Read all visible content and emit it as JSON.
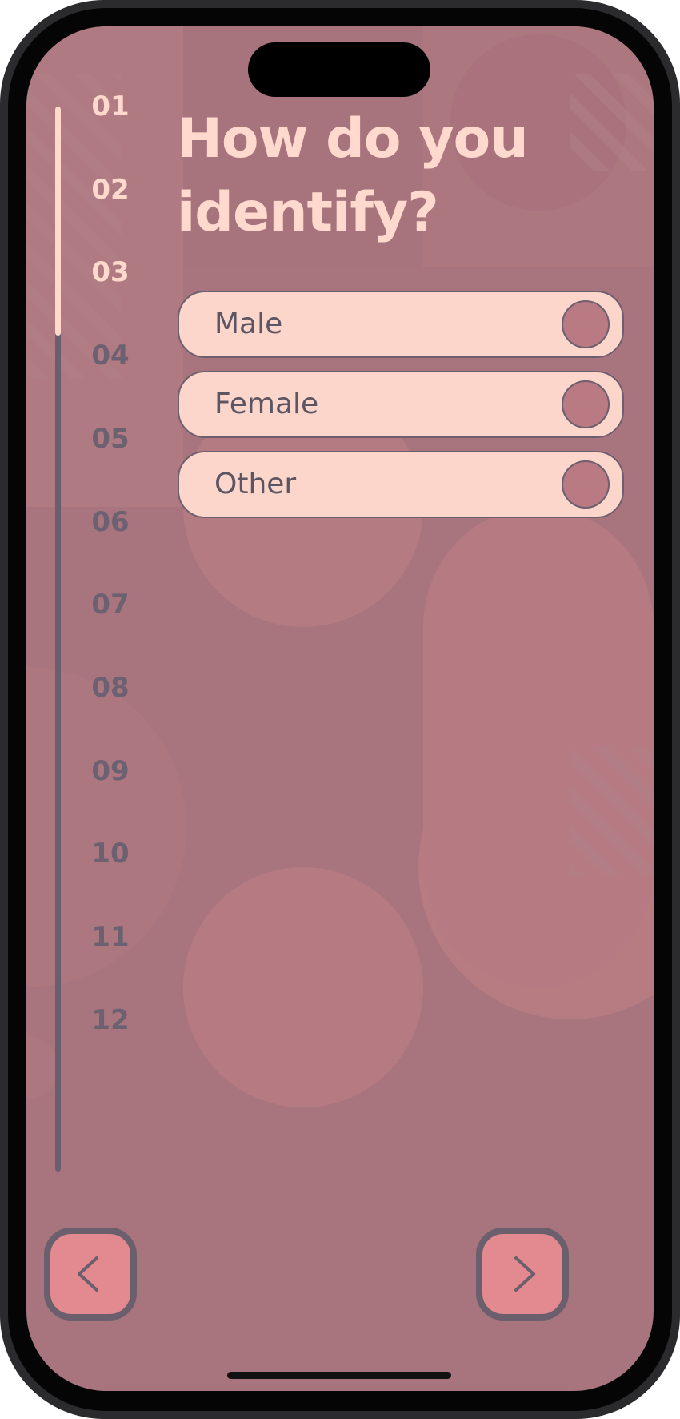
{
  "question": {
    "title_line1": "How do you",
    "title_line2": "identify?"
  },
  "steps": {
    "items": [
      "01",
      "02",
      "03",
      "04",
      "05",
      "06",
      "07",
      "08",
      "09",
      "10",
      "11",
      "12"
    ],
    "current": 3,
    "total": 12
  },
  "options": [
    {
      "label": "Male",
      "selected": false
    },
    {
      "label": "Female",
      "selected": false
    },
    {
      "label": "Other",
      "selected": false
    }
  ],
  "navigation": {
    "back_icon": "chevron-left-icon",
    "next_icon": "chevron-right-icon"
  },
  "colors": {
    "background": "#a8757e",
    "accent_light": "#ffd9cd",
    "option_bg": "#fdd6cb",
    "radio_fill": "#b97a83",
    "nav_button": "#e28a8f",
    "muted": "#6c6170"
  }
}
